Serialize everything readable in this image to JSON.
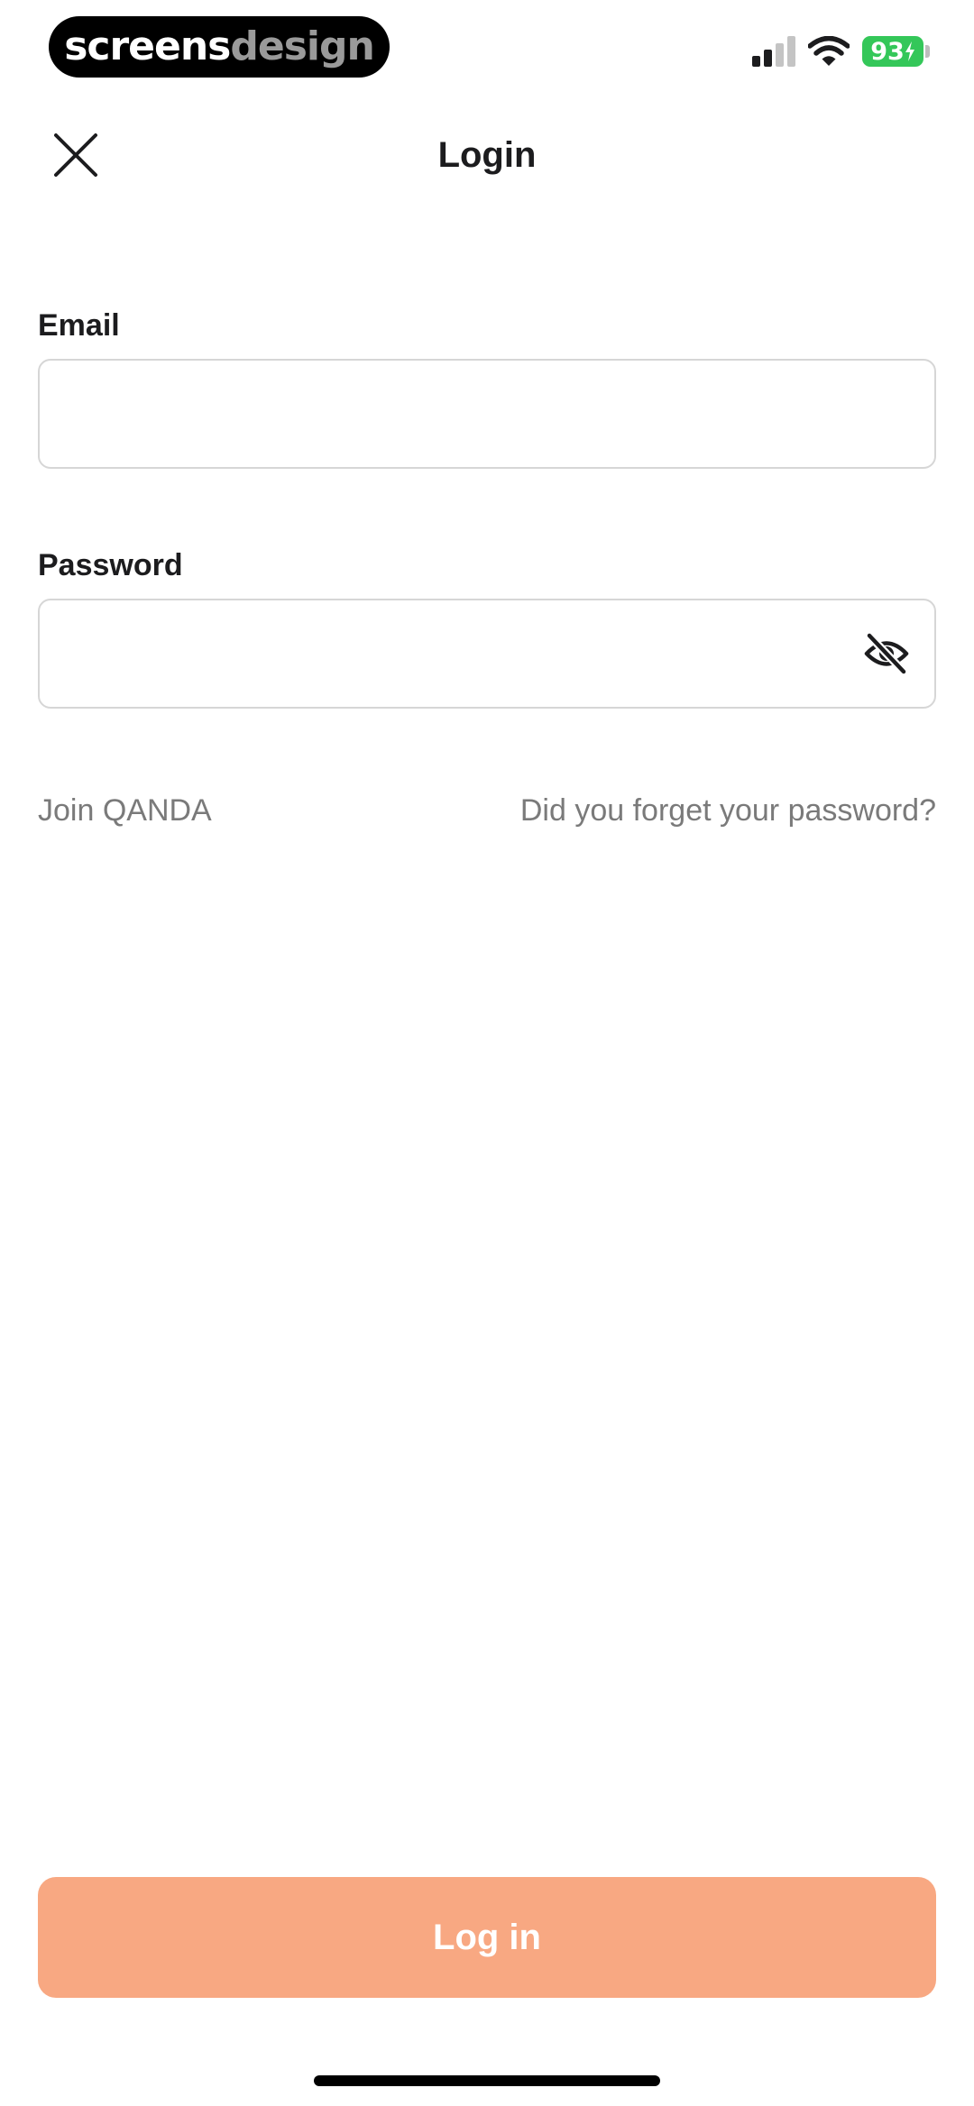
{
  "status_bar": {
    "brand_part1": "screens",
    "brand_part2": "design",
    "battery_level": "93",
    "icons": [
      "cellular-signal-icon",
      "wifi-icon",
      "battery-charging-icon"
    ]
  },
  "header": {
    "title": "Login",
    "close_icon": "close-icon"
  },
  "form": {
    "email": {
      "label": "Email",
      "value": "",
      "placeholder": ""
    },
    "password": {
      "label": "Password",
      "value": "",
      "placeholder": "",
      "visibility_icon": "eye-slash-icon"
    }
  },
  "links": {
    "join": "Join QANDA",
    "forgot": "Did you forget your password?"
  },
  "login_button": {
    "label": "Log in"
  },
  "colors": {
    "accent": "#f8a882",
    "battery": "#34c759",
    "link_text": "#7a7a7a",
    "border": "#d6d6d6"
  }
}
